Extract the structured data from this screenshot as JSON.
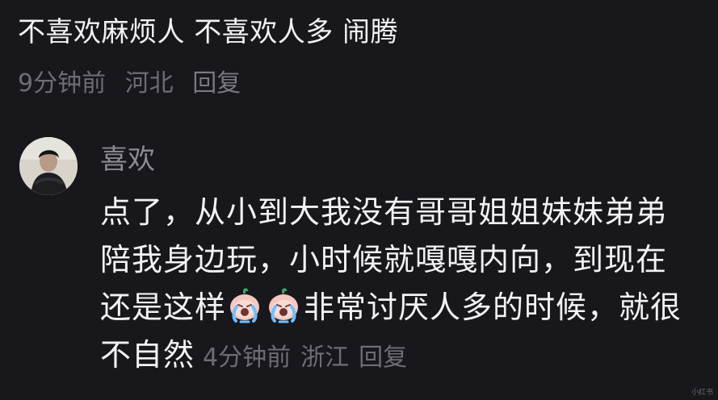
{
  "comment_top": {
    "text": "不喜欢麻烦人 不喜欢人多 闹腾",
    "time": "9分钟前",
    "location": "河北",
    "reply_label": "回复"
  },
  "comment_reply": {
    "username": "喜欢",
    "content_before_emoji": "点了，从小到大我没有哥哥姐姐妹妹弟弟陪我身边玩，小时候就嘎嘎内向，到现在还是这样",
    "emoji_icon": "crying-face-icon",
    "content_after_emoji": "非常讨厌人多的时候，就很不自然",
    "time": "4分钟前",
    "location": "浙江",
    "reply_label": "回复"
  },
  "watermark": "小红书"
}
